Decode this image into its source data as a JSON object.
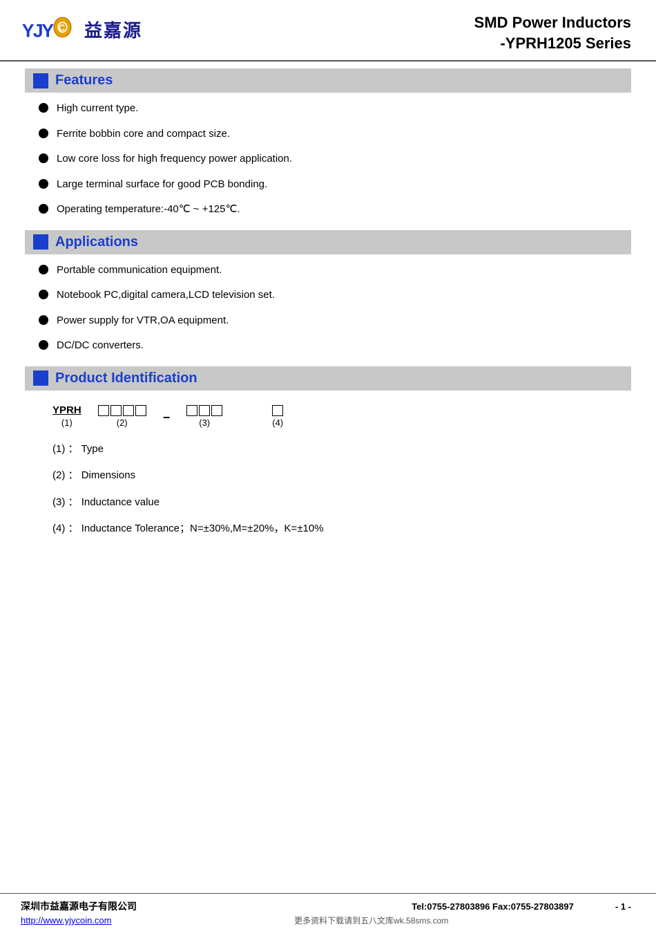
{
  "header": {
    "logo_text_cn": "益嘉源",
    "title_line1": "SMD Power Inductors",
    "title_line2": "-YPRH1205 Series"
  },
  "sections": {
    "features": {
      "title": "Features",
      "items": [
        "High current type.",
        "Ferrite bobbin core and compact size.",
        "Low core loss for high frequency power application.",
        "Large terminal surface for good PCB bonding.",
        "Operating temperature:-40℃  ~ +125℃."
      ]
    },
    "applications": {
      "title": "Applications",
      "items": [
        "Portable communication equipment.",
        "Notebook PC,digital camera,LCD television set.",
        "Power supply for VTR,OA equipment.",
        "DC/DC converters."
      ]
    },
    "product_id": {
      "title": "Product Identification",
      "code_prefix": "YPRH",
      "num1": "(1)",
      "num2": "(2)",
      "num3": "(3)",
      "num4": "(4)",
      "details": [
        {
          "num": "(1)",
          "desc": "Type"
        },
        {
          "num": "(2)",
          "desc": "Dimensions"
        },
        {
          "num": "(3)",
          "desc": "Inductance value"
        },
        {
          "num": "(4)",
          "desc": "Inductance Tolerance；N=±30%,M=±20%，K=±10%"
        }
      ]
    }
  },
  "footer": {
    "company": "深圳市益嘉源电子有限公司",
    "contact": "Tel:0755-27803896   Fax:0755-27803897",
    "page": "- 1 -",
    "url": "http://www.yjycoin.com",
    "watermark": "更多资料下载请到五八文库wk.58sms.com"
  }
}
